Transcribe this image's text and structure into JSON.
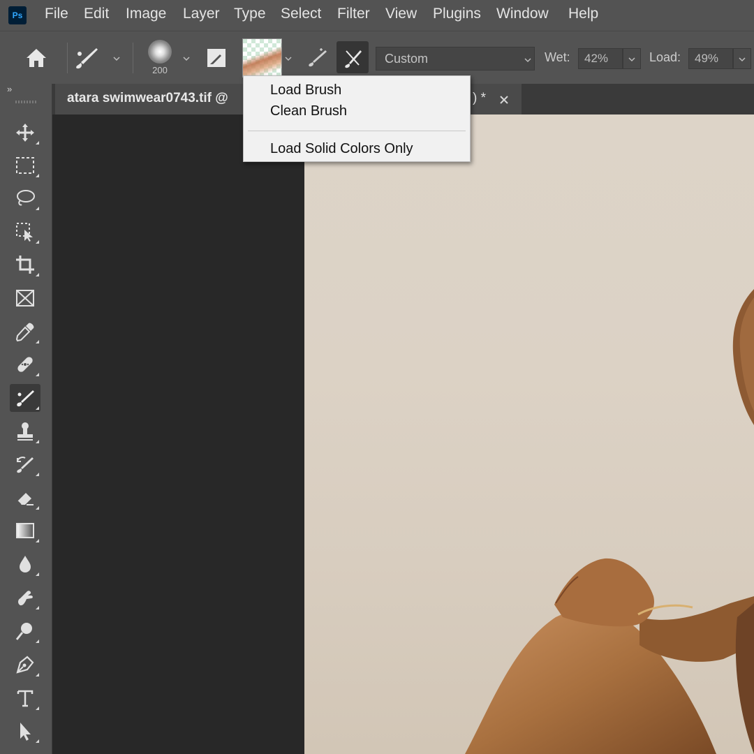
{
  "app": {
    "logo": "Ps"
  },
  "menubar": {
    "items": [
      "File",
      "Edit",
      "Image",
      "Layer",
      "Type",
      "Select",
      "Filter",
      "View",
      "Plugins",
      "Window",
      "Help"
    ]
  },
  "options": {
    "brush_size": "200",
    "preset": "Custom",
    "wet_label": "Wet:",
    "wet_value": "42%",
    "load_label": "Load:",
    "load_value": "49%"
  },
  "document": {
    "tab_title": "atara swimwear0743.tif @",
    "tab_suffix": ") *"
  },
  "context_menu": {
    "items": [
      "Load Brush",
      "Clean Brush",
      "Load Solid Colors Only"
    ]
  },
  "icons": {
    "toolbar": [
      "move-icon",
      "marquee-icon",
      "lasso-icon",
      "object-select-icon",
      "crop-icon",
      "frame-icon",
      "eyedropper-icon",
      "healing-icon",
      "mixer-brush-icon",
      "stamp-icon",
      "history-brush-icon",
      "eraser-icon",
      "gradient-icon",
      "blur-icon",
      "smudge-icon",
      "dodge-icon",
      "pen-icon",
      "type-icon",
      "path-select-icon"
    ]
  },
  "colors": {
    "chrome": "#535353",
    "workspace": "#282828",
    "canvas": "#ddd4c8",
    "menu_bg": "#f1f1f1"
  }
}
